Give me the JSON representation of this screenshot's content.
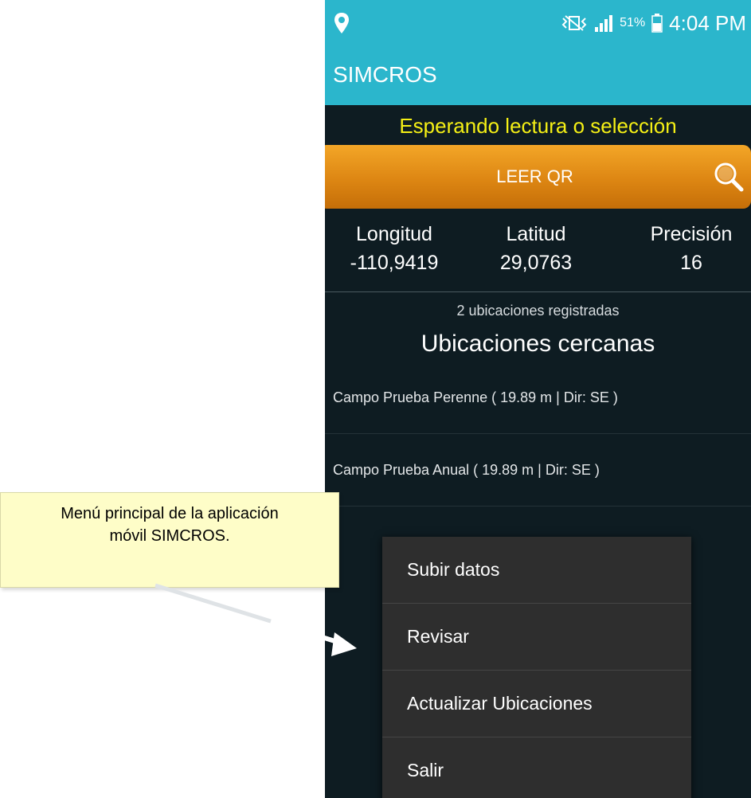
{
  "status_bar": {
    "battery_pct": "51%",
    "time": "4:04 PM",
    "icons": [
      "location-icon",
      "vibrate-icon",
      "signal-icon",
      "battery-icon"
    ]
  },
  "app_bar": {
    "title": "SIMCROS"
  },
  "status_message": "Esperando lectura o selección",
  "qr_button": {
    "label": "LEER QR",
    "icon": "search-icon"
  },
  "coordinates": {
    "longitude": {
      "label": "Longitud",
      "value": "-110,9419"
    },
    "latitude": {
      "label": "Latitud",
      "value": "29,0763"
    },
    "precision": {
      "label": "Precisión",
      "value": "16"
    }
  },
  "nearby": {
    "registered_count_text": "2 ubicaciones registradas",
    "title": "Ubicaciones cercanas",
    "items": [
      {
        "label": "Campo Prueba Perenne ( 19.89 m | Dir: SE )"
      },
      {
        "label": "Campo Prueba Anual ( 19.89 m | Dir: SE )"
      }
    ]
  },
  "menu": {
    "items": [
      {
        "label": "Subir datos"
      },
      {
        "label": "Revisar"
      },
      {
        "label": "Actualizar Ubicaciones"
      },
      {
        "label": "Salir"
      }
    ]
  },
  "callout": {
    "line1": "Menú principal de la aplicación",
    "line2": "móvil SIMCROS."
  },
  "colors": {
    "app_bar": "#2bb6cc",
    "background": "#0e1c22",
    "status_message": "#f5f015",
    "button": "#dd8613",
    "menu": "#2e2e2e",
    "callout": "#fefdc8"
  }
}
